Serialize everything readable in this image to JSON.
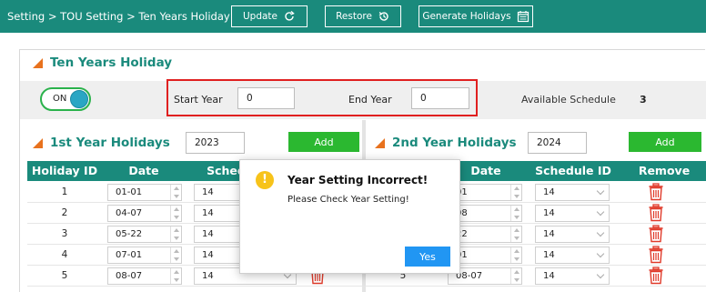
{
  "topbar": {
    "breadcrumb": "Setting > TOU Setting > Ten Years Holiday",
    "update_label": "Update",
    "restore_label": "Restore",
    "generate_label": "Generate Holidays"
  },
  "ten_years": {
    "title": "Ten Years Holiday",
    "toggle_label": "ON",
    "start_year_label": "Start Year",
    "start_year_value": "0",
    "end_year_label": "End Year",
    "end_year_value": "0",
    "available_label": "Available Schedule",
    "available_value": "3"
  },
  "left_panel": {
    "title": "1st Year Holidays",
    "year_value": "2023",
    "add_label": "Add",
    "headers": {
      "id": "Holiday ID",
      "date": "Date",
      "schedule": "Schedule ID"
    },
    "rows": [
      {
        "id": "1",
        "date": "01-01",
        "schedule": "14"
      },
      {
        "id": "2",
        "date": "04-07",
        "schedule": "14"
      },
      {
        "id": "3",
        "date": "05-22",
        "schedule": "14"
      },
      {
        "id": "4",
        "date": "07-01",
        "schedule": "14"
      },
      {
        "id": "5",
        "date": "08-07",
        "schedule": "14"
      }
    ]
  },
  "right_panel": {
    "title": "2nd Year Holidays",
    "year_value": "2024",
    "add_label": "Add",
    "headers": {
      "date": "Date",
      "schedule": "Schedule ID",
      "remove": "Remove"
    },
    "rows": [
      {
        "id": "",
        "date": "01",
        "schedule": "14"
      },
      {
        "id": "",
        "date": "08",
        "schedule": "14"
      },
      {
        "id": "",
        "date": "22",
        "schedule": "14"
      },
      {
        "id": "",
        "date": "01",
        "schedule": "14"
      },
      {
        "id": "5",
        "date": "08-07",
        "schedule": "14"
      }
    ]
  },
  "modal": {
    "title": "Year Setting Incorrect!",
    "message": "Please Check Year Setting!",
    "yes_label": "Yes"
  },
  "colors": {
    "teal": "#1a8a7c",
    "accent_orange": "#e8721e",
    "add_green": "#2bb830",
    "remove_red": "#e03a2a",
    "highlight_red": "#e02020",
    "yes_blue": "#2196f3"
  },
  "icons": {
    "update": "refresh-icon",
    "restore": "history-icon",
    "generate": "calendar-icon",
    "remove": "trash-icon",
    "warning": "warning-icon"
  }
}
